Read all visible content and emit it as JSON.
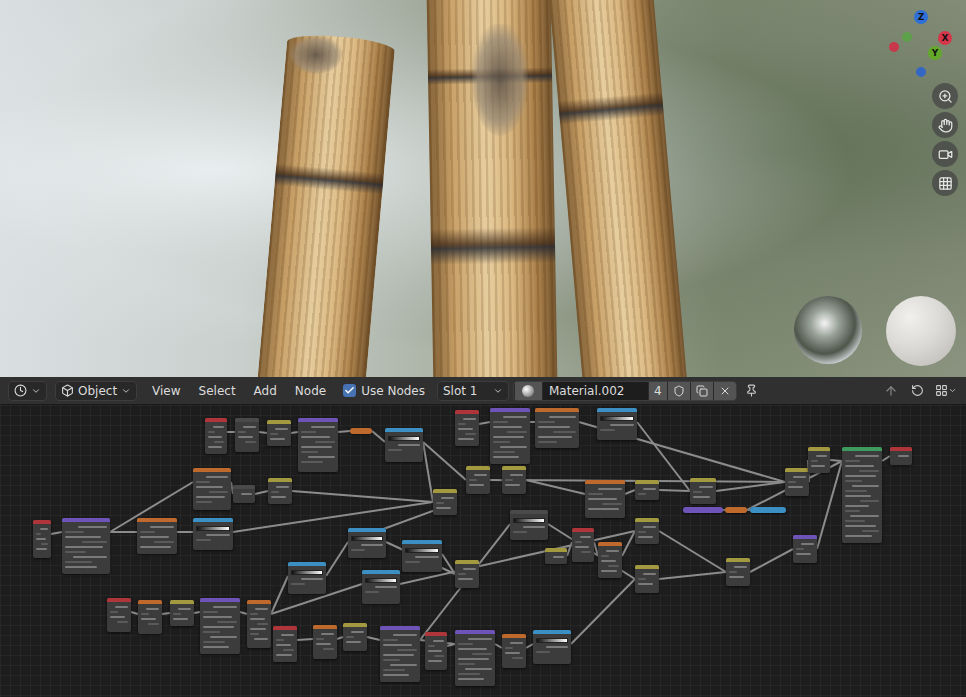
{
  "viewport": {
    "gizmo_axes": [
      {
        "label": "Z",
        "color": "#2f6fd8"
      },
      {
        "label": "Y",
        "color": "#63a82a"
      },
      {
        "label": "X",
        "color": "#d6364a"
      }
    ],
    "gizmo_dots": [
      {
        "color": "#5fa04a"
      },
      {
        "color": "#c8374a"
      },
      {
        "color": "#3466c4"
      }
    ]
  },
  "header": {
    "mode": "Object",
    "menus": [
      "View",
      "Select",
      "Add",
      "Node"
    ],
    "use_nodes": {
      "label": "Use Nodes",
      "checked": true
    },
    "slot": "Slot 1",
    "material": "Material.002",
    "users": "4"
  },
  "nodes": [
    {
      "kind": "node",
      "color": "#b0353b"
    },
    {
      "kind": "node",
      "color": "#4a4a4a"
    },
    {
      "kind": "node",
      "color": "#a39a3f"
    },
    {
      "kind": "node",
      "color": "#6e54b8"
    },
    {
      "kind": "pill",
      "color": "#c0692c"
    },
    {
      "kind": "ramp",
      "color": "#3b8fc2"
    },
    {
      "kind": "node",
      "color": "#b0353b"
    },
    {
      "kind": "node",
      "color": "#6e54b8"
    },
    {
      "kind": "node",
      "color": "#c0692c"
    },
    {
      "kind": "ramp",
      "color": "#3b8fc2"
    },
    {
      "kind": "node",
      "color": "#c0692c"
    },
    {
      "kind": "node",
      "color": "#4a4a4a"
    },
    {
      "kind": "node",
      "color": "#a39a3f"
    },
    {
      "kind": "node",
      "color": "#a39a3f"
    },
    {
      "kind": "node",
      "color": "#a39a3f"
    },
    {
      "kind": "node",
      "color": "#a39a3f"
    },
    {
      "kind": "node",
      "color": "#c0692c"
    },
    {
      "kind": "node",
      "color": "#a39a3f"
    },
    {
      "kind": "node",
      "color": "#a39a3f"
    },
    {
      "kind": "node",
      "color": "#a39a3f"
    },
    {
      "kind": "node",
      "color": "#a39a3f"
    },
    {
      "kind": "node",
      "color": "#3e9b5d"
    },
    {
      "kind": "node",
      "color": "#b0353b"
    },
    {
      "kind": "node",
      "color": "#b0353b"
    },
    {
      "kind": "node",
      "color": "#6e54b8"
    },
    {
      "kind": "node",
      "color": "#c0692c"
    },
    {
      "kind": "ramp",
      "color": "#3b8fc2"
    },
    {
      "kind": "ramp",
      "color": "#4a4a4a"
    },
    {
      "kind": "ramp",
      "color": "#3b8fc2"
    },
    {
      "kind": "ramp",
      "color": "#3b8fc2"
    },
    {
      "kind": "ramp",
      "color": "#3b8fc2"
    },
    {
      "kind": "ramp",
      "color": "#3b8fc2"
    },
    {
      "kind": "node",
      "color": "#a39a3f"
    },
    {
      "kind": "node",
      "color": "#a39a3f"
    },
    {
      "kind": "node",
      "color": "#b0353b"
    },
    {
      "kind": "node",
      "color": "#c0692c"
    },
    {
      "kind": "node",
      "color": "#a39a3f"
    },
    {
      "kind": "node",
      "color": "#a39a3f"
    },
    {
      "kind": "node",
      "color": "#a39a3f"
    },
    {
      "kind": "node",
      "color": "#6e54b8"
    },
    {
      "kind": "pill",
      "color": "#6e54b8"
    },
    {
      "kind": "pill",
      "color": "#c0692c"
    },
    {
      "kind": "pill",
      "color": "#3b8fc2"
    },
    {
      "kind": "node",
      "color": "#b0353b"
    },
    {
      "kind": "node",
      "color": "#c0692c"
    },
    {
      "kind": "node",
      "color": "#a39a3f"
    },
    {
      "kind": "node",
      "color": "#6e54b8"
    },
    {
      "kind": "node",
      "color": "#c0692c"
    },
    {
      "kind": "node",
      "color": "#b0353b"
    },
    {
      "kind": "node",
      "color": "#c0692c"
    },
    {
      "kind": "node",
      "color": "#a39a3f"
    },
    {
      "kind": "node",
      "color": "#6e54b8"
    },
    {
      "kind": "node",
      "color": "#b0353b"
    },
    {
      "kind": "node",
      "color": "#6e54b8"
    },
    {
      "kind": "node",
      "color": "#c0692c"
    },
    {
      "kind": "ramp",
      "color": "#3b8fc2"
    }
  ]
}
